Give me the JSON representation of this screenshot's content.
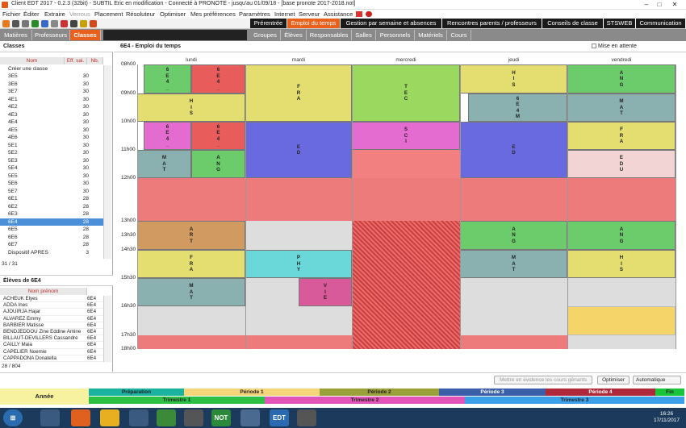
{
  "title": "Client EDT 2017 - 0.2.3 (32bit) - SUBTIL Eric en modification - Connecté à PRONOTE - jusqu'au 01/09/18 - [base pronote 2017-2018.not]",
  "menu": [
    "Fichier",
    "Éditer",
    "Extraire",
    "Verrous",
    "Placement",
    "Résoluteur",
    "Optimiser",
    "Mes préférences",
    "Paramètres",
    "Internet",
    "Serveur",
    "Assistance"
  ],
  "top_tabs": [
    "Prérentrée",
    "Emploi du temps",
    "Gestion par semaine et absences",
    "Rencontres parents / professeurs",
    "Conseils de classe",
    "STSWEB",
    "Communication"
  ],
  "sub_tabs_left": [
    "Matières",
    "Professeurs",
    "Classes"
  ],
  "sub_tabs_right": [
    "Groupes",
    "Élèves",
    "Responsables",
    "Salles",
    "Personnels",
    "Matériels",
    "Cours"
  ],
  "classes": {
    "header": "Classes",
    "col_nom": "Nom",
    "col_eff": "Eff. sai.",
    "col_nb": "Nb.",
    "create": "Créer une classe",
    "rows": [
      [
        "3E5",
        "30"
      ],
      [
        "3E6",
        "30"
      ],
      [
        "3E7",
        "30"
      ],
      [
        "4E1",
        "30"
      ],
      [
        "4E2",
        "30"
      ],
      [
        "4E3",
        "30"
      ],
      [
        "4E4",
        "30"
      ],
      [
        "4E5",
        "30"
      ],
      [
        "4E6",
        "30"
      ],
      [
        "5E1",
        "30"
      ],
      [
        "5E2",
        "30"
      ],
      [
        "5E3",
        "30"
      ],
      [
        "5E4",
        "30"
      ],
      [
        "5E5",
        "30"
      ],
      [
        "5E6",
        "30"
      ],
      [
        "5E7",
        "30"
      ],
      [
        "6E1",
        "28"
      ],
      [
        "6E2",
        "28"
      ],
      [
        "6E3",
        "28"
      ],
      [
        "6E4",
        "28"
      ],
      [
        "6E5",
        "28"
      ],
      [
        "6E6",
        "28"
      ],
      [
        "6E7",
        "28"
      ],
      [
        "Dispositif APRES",
        "3"
      ]
    ],
    "pager": "31 / 31"
  },
  "students": {
    "header": "Élèves de 6E4",
    "col": "Nom prénom",
    "rows": [
      [
        "ACHEUK Elyes",
        "6E4"
      ],
      [
        "ADDA Ines",
        "6E4"
      ],
      [
        "AJOUIRJA Hajar",
        "6E4"
      ],
      [
        "ALVAREZ Emmy",
        "6E4"
      ],
      [
        "BARBIER Matisse",
        "6E4"
      ],
      [
        "BENDJEDDOU Zine Eddine Amine",
        "6E4"
      ],
      [
        "BILLAUT-DEVILLERS Cassandre",
        "6E4"
      ],
      [
        "CAILLY Maia",
        "6E4"
      ],
      [
        "CAPELIER Noemie",
        "6E4"
      ],
      [
        "CAPPADONA Donatella",
        "6E4"
      ]
    ],
    "pager": "28 / 804"
  },
  "main_title": "6E4 - Emploi du temps",
  "mise_en_attente": "Mise en attente",
  "days": [
    "lundi",
    "mardi",
    "mercredi",
    "jeudi",
    "vendredi"
  ],
  "hours": [
    "08h00",
    "09h00",
    "10h00",
    "11h00",
    "12h00",
    "13h00",
    "13h30",
    "14h30",
    "15h30",
    "16h30",
    "17h30",
    "18h00"
  ],
  "courses": {
    "c1": "6E4_P1|ANGLAIS LV1|CHAFFENET C.|[6E4_P1]",
    "c2": "6E4_P2|ACCOMP. PERS...|DECORSAIRE F.|",
    "c3": "HIST.GEO.EN.MOR.CIV.|SULMONT T.|113",
    "c4": "FRANCAIS|DECORSAIRE F.|02",
    "c5": "TECHNOLOGIE|GUENFOUD A.|1002 Techno",
    "c6": "HIST.GEO.EN.MOR.CIV.|SULMONT T.|113",
    "c7": "6E4MATHS_1|MATHEMATIQUES|CAMPRUBI F.|[6E4MATHS_1]",
    "c8": "ANGLAIS LV1|CHAFFENET C.|107",
    "c9": "MATHEMATIQUES|PHILIPPE E.|212",
    "c10": "6E4_P1|SCIENCES VI...|MICHON PEL...|110 SVT",
    "c11": "6E4_P2|ACCOMP. PERS...|DECORSAIRE F.|",
    "c12": "ED.PHYSIQUE & SPORT.|DALLOZ F.",
    "c13": "SCIENCES VIE & TERRE|MICHON PELARDY L.|102 SVT",
    "c14": "ED.PHYSIQUE & SPORT.|DALLOZ F.",
    "c15": "FRANCAIS|DECORSAIRE F.|02",
    "c16": "MATHEMATIQUES|PHILIPPE E.|210 Art.Pla 2",
    "c17": "ANGLAIS LV1|CHAFFENET C.|109",
    "c18": "EDUCATION MUSICALE|BEAULIEU Y.|207 Musique 1",
    "c19": "ARTS PLASTIQUES|HOLSTEIN M.|206 Art.Pla 1",
    "c20": "ANGLAIS LV1|CHAFFENET C.|105",
    "c21": "ANGLAIS LV1|CHAFFENET C.|103",
    "c22": "FRANCAIS|DECORSAIRE F.|02",
    "c23": "PHYSIQUE-CHIMIE|MSAKNI N.|106 SPC",
    "c24": "MATHEMATIQUES|PHILIPPE E.|202",
    "c25": "HIST.GEO.EN.MOR.CIV.|SULMONT T.|113",
    "c26": "MATHEMATIQUES|PHILIPPE E.|212",
    "c27": "VIE DE CLASSE|CHAFFENET C.|107|0"
  },
  "bottom": {
    "btn_mettre": "Mettre en évidence les cours gênants",
    "btn_opt": "Optimiser",
    "select": "Automatique"
  },
  "periods": {
    "annee": "Année",
    "preparation": "Préparation",
    "p1": "Période 1",
    "p2": "Période 2",
    "p3": "Période 3",
    "p4": "Période 4",
    "fin": "Fin",
    "t1": "Trimestre 1",
    "t2": "Trimestre 2",
    "t3": "Trimestre 3"
  },
  "taskbar": {
    "time": "16:26",
    "date": "17/11/2017",
    "not": "NOT",
    "edt": "EDT"
  }
}
